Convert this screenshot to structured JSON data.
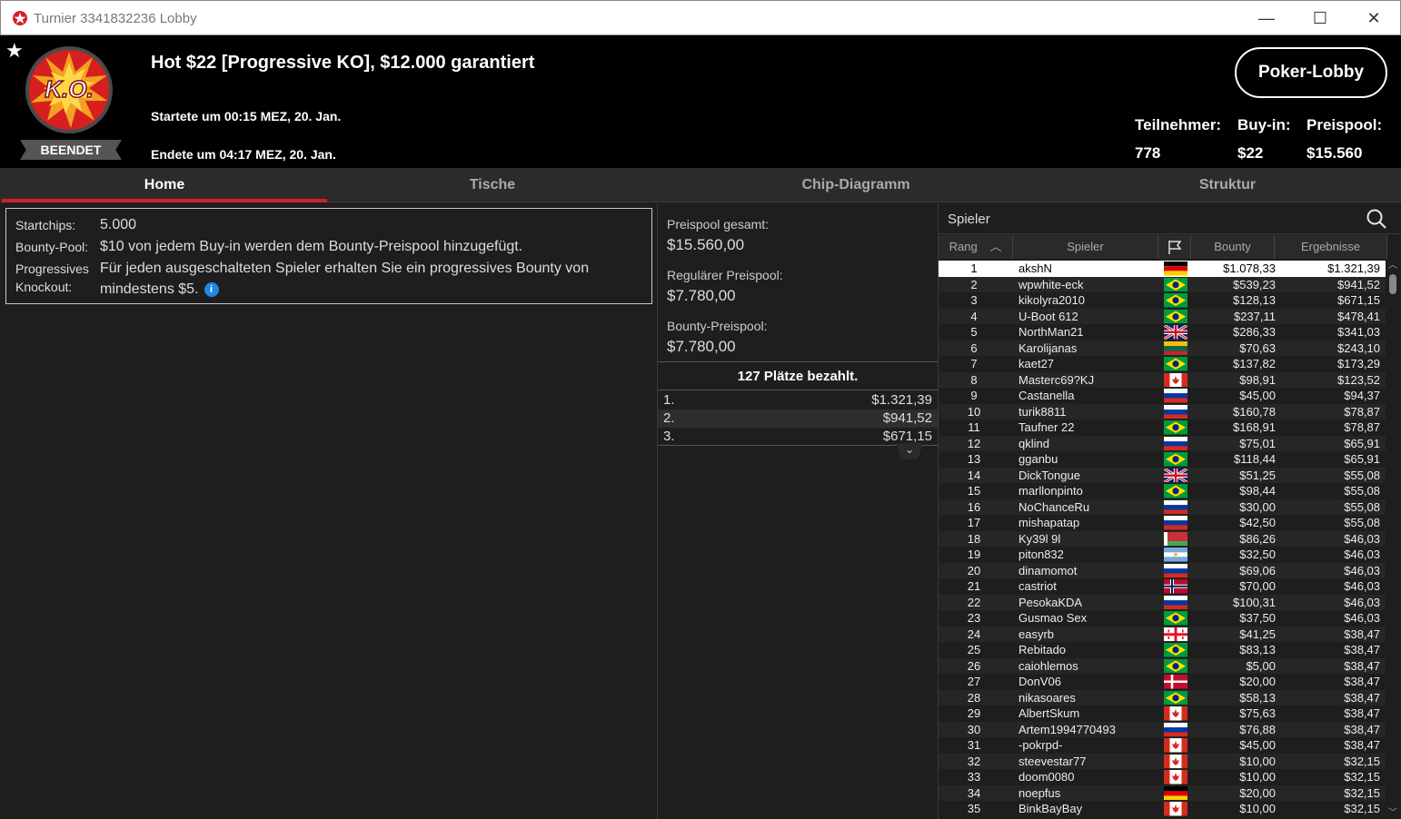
{
  "window": {
    "title": "Turnier 3341832236 Lobby",
    "minimize": "—",
    "maximize": "☐",
    "close": "✕"
  },
  "header": {
    "badge_text": "K.O.",
    "status": "BEENDET",
    "title": "Hot $22 [Progressive KO], $12.000 garantiert",
    "started": "Startete um 00:15 MEZ, 20. Jan.",
    "ended": "Endete um 04:17 MEZ, 20. Jan.",
    "lobby_button": "Poker-Lobby",
    "stats": {
      "participants_label": "Teilnehmer:",
      "participants_value": "778",
      "buyin_label": "Buy-in:",
      "buyin_value": "$22",
      "prizepool_label": "Preispool:",
      "prizepool_value": "$15.560"
    }
  },
  "tabs": [
    "Home",
    "Tische",
    "Chip-Diagramm",
    "Struktur"
  ],
  "info": {
    "startchips_label": "Startchips:",
    "startchips_value": "5.000",
    "bountypool_label": "Bounty-Pool:",
    "bountypool_value": "$10 von jedem Buy-in werden dem Bounty-Preispool hinzugefügt.",
    "pko_label_1": "Progressives",
    "pko_label_2": "Knockout:",
    "pko_value_1": "Für jeden ausgeschalteten Spieler erhalten Sie ein progressives Bounty von",
    "pko_value_2": "mindestens $5.",
    "info_icon": "i"
  },
  "prize": {
    "total_label": "Preispool gesamt:",
    "total_value": "$15.560,00",
    "regular_label": "Regulärer Preispool:",
    "regular_value": "$7.780,00",
    "bounty_label": "Bounty-Preispool:",
    "bounty_value": "$7.780,00",
    "paid_header": "127 Plätze bezahlt.",
    "payouts": [
      {
        "rank": "1.",
        "amount": "$1.321,39"
      },
      {
        "rank": "2.",
        "amount": "$941,52"
      },
      {
        "rank": "3.",
        "amount": "$671,15"
      }
    ]
  },
  "players": {
    "search_label": "Spieler",
    "col_rank": "Rang",
    "col_player": "Spieler",
    "col_bounty": "Bounty",
    "col_results": "Ergebnisse",
    "rows": [
      {
        "rank": "1",
        "name": "akshN",
        "flag": "de",
        "bounty": "$1.078,33",
        "result": "$1.321,39"
      },
      {
        "rank": "2",
        "name": "wpwhite-eck",
        "flag": "br",
        "bounty": "$539,23",
        "result": "$941,52"
      },
      {
        "rank": "3",
        "name": "kikolyra2010",
        "flag": "br",
        "bounty": "$128,13",
        "result": "$671,15"
      },
      {
        "rank": "4",
        "name": "U-Boot 612",
        "flag": "br",
        "bounty": "$237,11",
        "result": "$478,41"
      },
      {
        "rank": "5",
        "name": "NorthMan21",
        "flag": "gb",
        "bounty": "$286,33",
        "result": "$341,03"
      },
      {
        "rank": "6",
        "name": "Karolijanas",
        "flag": "lt",
        "bounty": "$70,63",
        "result": "$243,10"
      },
      {
        "rank": "7",
        "name": "kaet27",
        "flag": "br",
        "bounty": "$137,82",
        "result": "$173,29"
      },
      {
        "rank": "8",
        "name": "Masterc69?KJ",
        "flag": "ca",
        "bounty": "$98,91",
        "result": "$123,52"
      },
      {
        "rank": "9",
        "name": "Castanella",
        "flag": "ru",
        "bounty": "$45,00",
        "result": "$94,37"
      },
      {
        "rank": "10",
        "name": "turik8811",
        "flag": "ru",
        "bounty": "$160,78",
        "result": "$78,87"
      },
      {
        "rank": "11",
        "name": "Taufner 22",
        "flag": "br",
        "bounty": "$168,91",
        "result": "$78,87"
      },
      {
        "rank": "12",
        "name": "qklind",
        "flag": "ru",
        "bounty": "$75,01",
        "result": "$65,91"
      },
      {
        "rank": "13",
        "name": "gganbu",
        "flag": "br",
        "bounty": "$118,44",
        "result": "$65,91"
      },
      {
        "rank": "14",
        "name": "DickTongue",
        "flag": "gb",
        "bounty": "$51,25",
        "result": "$55,08"
      },
      {
        "rank": "15",
        "name": "marllonpinto",
        "flag": "br",
        "bounty": "$98,44",
        "result": "$55,08"
      },
      {
        "rank": "16",
        "name": "NoChanceRu",
        "flag": "ru",
        "bounty": "$30,00",
        "result": "$55,08"
      },
      {
        "rank": "17",
        "name": "mishapatap",
        "flag": "ru",
        "bounty": "$42,50",
        "result": "$55,08"
      },
      {
        "rank": "18",
        "name": "Ky39l 9l",
        "flag": "by",
        "bounty": "$86,26",
        "result": "$46,03"
      },
      {
        "rank": "19",
        "name": "piton832",
        "flag": "ar",
        "bounty": "$32,50",
        "result": "$46,03"
      },
      {
        "rank": "20",
        "name": "dinamomot",
        "flag": "ru",
        "bounty": "$69,06",
        "result": "$46,03"
      },
      {
        "rank": "21",
        "name": "castriot",
        "flag": "no",
        "bounty": "$70,00",
        "result": "$46,03"
      },
      {
        "rank": "22",
        "name": "PesokaKDA",
        "flag": "ru",
        "bounty": "$100,31",
        "result": "$46,03"
      },
      {
        "rank": "23",
        "name": "Gusmao Sex",
        "flag": "br",
        "bounty": "$37,50",
        "result": "$46,03"
      },
      {
        "rank": "24",
        "name": "easyrb",
        "flag": "ge",
        "bounty": "$41,25",
        "result": "$38,47"
      },
      {
        "rank": "25",
        "name": "Rebitado",
        "flag": "br",
        "bounty": "$83,13",
        "result": "$38,47"
      },
      {
        "rank": "26",
        "name": "caiohlemos",
        "flag": "br",
        "bounty": "$5,00",
        "result": "$38,47"
      },
      {
        "rank": "27",
        "name": "DonV06",
        "flag": "dk",
        "bounty": "$20,00",
        "result": "$38,47"
      },
      {
        "rank": "28",
        "name": "nikasoares",
        "flag": "br",
        "bounty": "$58,13",
        "result": "$38,47"
      },
      {
        "rank": "29",
        "name": "AlbertSkum",
        "flag": "ca",
        "bounty": "$75,63",
        "result": "$38,47"
      },
      {
        "rank": "30",
        "name": "Artem1994770493",
        "flag": "ru",
        "bounty": "$76,88",
        "result": "$38,47"
      },
      {
        "rank": "31",
        "name": "-pokrpd-",
        "flag": "ca",
        "bounty": "$45,00",
        "result": "$38,47"
      },
      {
        "rank": "32",
        "name": "steevestar77",
        "flag": "ca",
        "bounty": "$10,00",
        "result": "$32,15"
      },
      {
        "rank": "33",
        "name": "doom0080",
        "flag": "ca",
        "bounty": "$10,00",
        "result": "$32,15"
      },
      {
        "rank": "34",
        "name": "noepfus",
        "flag": "de",
        "bounty": "$20,00",
        "result": "$32,15"
      },
      {
        "rank": "35",
        "name": "BinkBayBay",
        "flag": "ca",
        "bounty": "$10,00",
        "result": "$32,15"
      }
    ]
  },
  "colors": {
    "accent_red": "#d31f26",
    "background": "#1e1e1e",
    "header_bg": "#000000"
  }
}
